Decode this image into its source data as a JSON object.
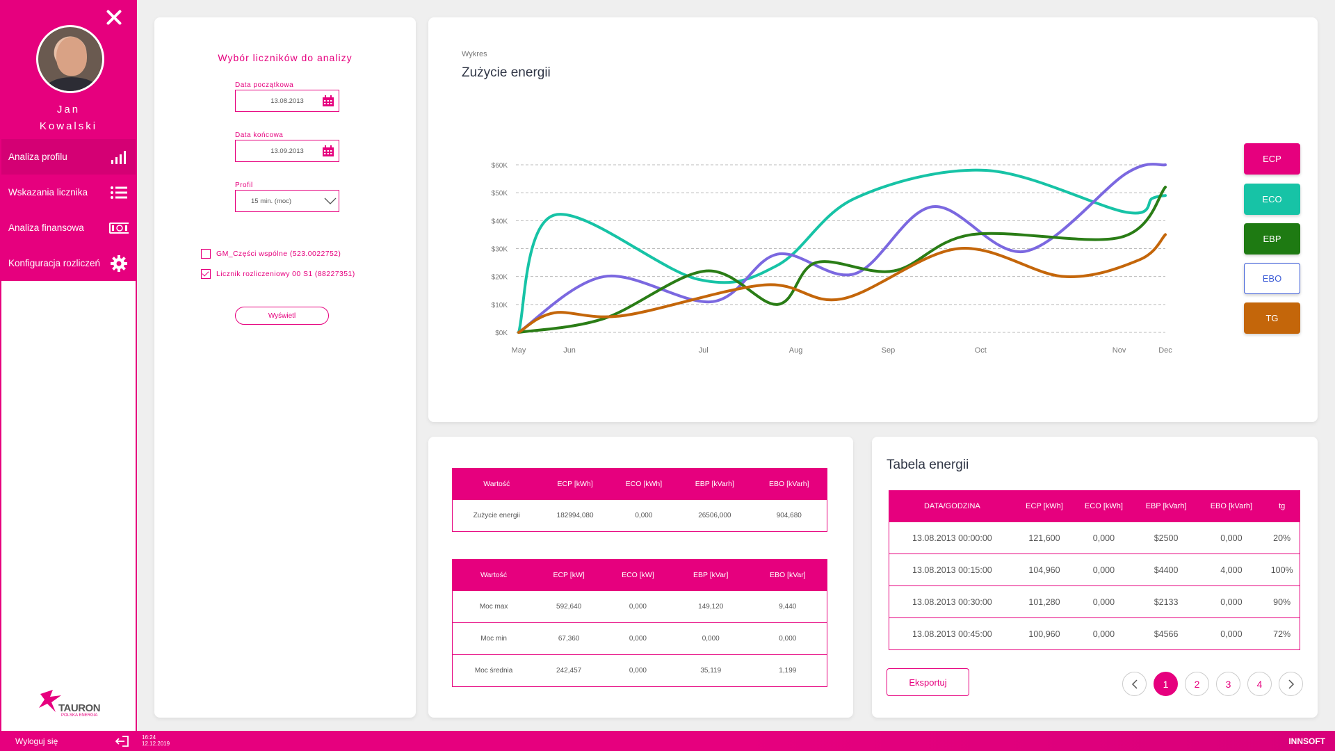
{
  "user": {
    "first_name": "Jan",
    "last_name": "Kowalski"
  },
  "nav": [
    {
      "label": "Analiza profilu",
      "icon": "signal-bars-icon"
    },
    {
      "label": "Wskazania licznika",
      "icon": "list-icon"
    },
    {
      "label": "Analiza finansowa",
      "icon": "money-icon"
    },
    {
      "label": "Konfiguracja rozliczeń",
      "icon": "gear-icon"
    }
  ],
  "brand": {
    "logo": "TAURON",
    "logo_sub": "POLSKA ENERGIA",
    "vendor": "INNSOFT"
  },
  "footer": {
    "logout": "Wyloguj się",
    "time": "16:24",
    "date": "12.12.2019"
  },
  "filters": {
    "title": "Wybór liczników do analizy",
    "start_label": "Data początkowa",
    "start_value": "13.08.2013",
    "end_label": "Data końcowa",
    "end_value": "13.09.2013",
    "profile_label": "Profil",
    "profile_value": "15 min. (moc)",
    "meters": [
      {
        "label": "GM_Części wspólne (523.0022752)",
        "checked": false
      },
      {
        "label": "Licznik rozliczeniowy 00 S1 (88227351)",
        "checked": true
      }
    ],
    "show_button": "Wyświetl"
  },
  "chart_card": {
    "subtitle": "Wykres",
    "title": "Zużycie energii"
  },
  "legend_colors": {
    "ECP": "#e6007e",
    "ECO": "#17c3a6",
    "EBP": "#1e7a12",
    "EBO": "#ffffff",
    "TG": "#c4660a"
  },
  "chart_data": {
    "type": "line",
    "x": [
      "May",
      "Jun",
      "Jul",
      "Aug",
      "Sep",
      "Oct",
      "Nov",
      "Dec"
    ],
    "y_ticks": [
      "$0K",
      "$10K",
      "$20K",
      "$30K",
      "$40K",
      "$50K",
      "$60K"
    ],
    "ylim": [
      0,
      60000
    ],
    "grid": true,
    "legend_position": "right",
    "legend": [
      "ECP",
      "ECO",
      "EBP",
      "EBO",
      "TG"
    ],
    "series": [
      {
        "name": "ECO",
        "color": "#17c3a6",
        "points": [
          [
            5.0,
            0
          ],
          [
            5.5,
            42000
          ],
          [
            6.4,
            19000
          ],
          [
            7.0,
            24000
          ],
          [
            7.6,
            48000
          ],
          [
            8.6,
            58000
          ],
          [
            9.4,
            43000
          ],
          [
            9.8,
            48000
          ],
          [
            10.0,
            49000
          ]
        ]
      },
      {
        "name": "",
        "color": "#7b68e0",
        "points": [
          [
            5.0,
            0
          ],
          [
            5.9,
            20000
          ],
          [
            6.5,
            11000
          ],
          [
            7.0,
            28000
          ],
          [
            7.6,
            21000
          ],
          [
            8.2,
            45000
          ],
          [
            8.8,
            29000
          ],
          [
            9.4,
            57000
          ],
          [
            10.0,
            60000
          ]
        ]
      },
      {
        "name": "EBP",
        "color": "#2a7d16",
        "points": [
          [
            5.0,
            0
          ],
          [
            5.9,
            5000
          ],
          [
            6.45,
            22000
          ],
          [
            7.0,
            10000
          ],
          [
            7.3,
            25000
          ],
          [
            7.9,
            22000
          ],
          [
            8.5,
            35000
          ],
          [
            9.3,
            34000
          ],
          [
            10.0,
            52000
          ]
        ]
      },
      {
        "name": "TG",
        "color": "#c4660a",
        "points": [
          [
            5.0,
            0
          ],
          [
            5.5,
            7000
          ],
          [
            6.0,
            6000
          ],
          [
            6.9,
            17000
          ],
          [
            7.5,
            12000
          ],
          [
            8.4,
            30000
          ],
          [
            9.0,
            20000
          ],
          [
            9.6,
            26000
          ],
          [
            10.0,
            35000
          ]
        ]
      }
    ]
  },
  "summary_table": {
    "headers": [
      "Wartość",
      "ECP [kWh]",
      "ECO [kWh]",
      "EBP [kVarh]",
      "EBO [kVarh]"
    ],
    "rows": [
      [
        "Zużycie energii",
        "182994,080",
        "0,000",
        "26506,000",
        "904,680"
      ]
    ]
  },
  "power_table": {
    "headers": [
      "Wartość",
      "ECP [kW]",
      "ECO [kW]",
      "EBP [kVar]",
      "EBO [kVar]"
    ],
    "rows": [
      [
        "Moc max",
        "592,640",
        "0,000",
        "149,120",
        "9,440"
      ],
      [
        "Moc min",
        "67,360",
        "0,000",
        "0,000",
        "0,000"
      ],
      [
        "Moc średnia",
        "242,457",
        "0,000",
        "35,119",
        "1,199"
      ]
    ]
  },
  "energy_table": {
    "title": "Tabela energii",
    "headers": [
      "DATA/GODZINA",
      "ECP [kWh]",
      "ECO [kWh]",
      "EBP [kVarh]",
      "EBO [kVarh]",
      "tg"
    ],
    "rows": [
      [
        "13.08.2013 00:00:00",
        "121,600",
        "0,000",
        "$2500",
        "0,000",
        "20%"
      ],
      [
        "13.08.2013 00:15:00",
        "104,960",
        "0,000",
        "$4400",
        "4,000",
        "100%"
      ],
      [
        "13.08.2013 00:30:00",
        "101,280",
        "0,000",
        "$2133",
        "0,000",
        "90%"
      ],
      [
        "13.08.2013 00:45:00",
        "100,960",
        "0,000",
        "$4566",
        "0,000",
        "72%"
      ]
    ],
    "export_button": "Eksportuj",
    "pages": [
      "1",
      "2",
      "3",
      "4"
    ],
    "current_page": "1"
  }
}
